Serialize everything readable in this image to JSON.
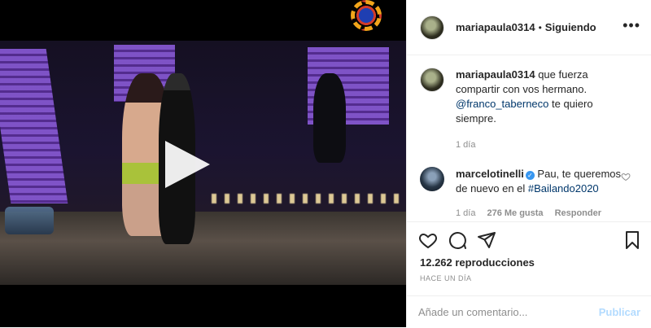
{
  "post": {
    "author": "mariapaula0314",
    "follow_status": "Siguiendo",
    "more_icon": "more-horizontal-icon"
  },
  "caption": {
    "author": "mariapaula0314",
    "text_before": " que fuerza compartir con vos hermano. ",
    "mention": "@franco_taberneco",
    "text_after": " te quiero siempre.",
    "time": "1 día"
  },
  "comment": {
    "author": "marcelotinelli",
    "verified_icon": "verified-badge-icon",
    "text": " Pau, te queremos de nuevo en el ",
    "hashtag": "#Bailando2020",
    "time": "1 día",
    "likes": "276 Me gusta",
    "reply": "Responder"
  },
  "stats": {
    "views": "12.262 reproducciones",
    "posted": "HACE UN DÍA"
  },
  "composer": {
    "placeholder": "Añade un comentario...",
    "post_label": "Publicar"
  },
  "colors": {
    "link": "#00376b",
    "verified": "#3897f0",
    "muted": "#8e8e8e",
    "publish_disabled": "#b3dbff"
  }
}
